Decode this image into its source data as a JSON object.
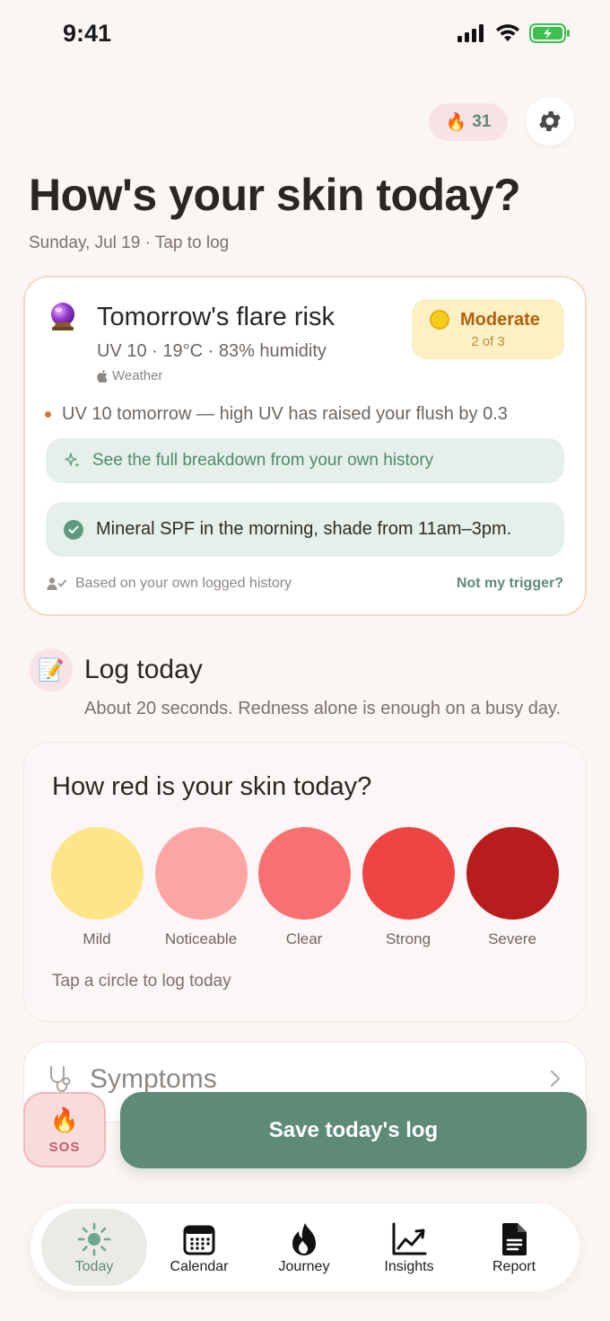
{
  "status_bar": {
    "time": "9:41"
  },
  "header": {
    "streak_count": "31",
    "streak_emoji": "🔥"
  },
  "page": {
    "title": "How's your skin today?",
    "subtitle": "Sunday, Jul 19 · Tap to log"
  },
  "flare_card": {
    "emoji": "🔮",
    "title": "Tomorrow's flare risk",
    "conditions": "UV 10 · 19°C · 83% humidity",
    "weather_source": "Weather",
    "risk_label": "Moderate",
    "risk_level": "2 of 3",
    "trigger_note": "UV 10 tomorrow — high UV has raised your flush by 0.3",
    "breakdown_link": "See the full breakdown from your own history",
    "advice": "Mineral SPF in the morning, shade from 11am–3pm.",
    "based_on": "Based on your own logged history",
    "not_trigger": "Not my trigger?",
    "colors": {
      "risk_bg": "#FDF0C4",
      "risk_text": "#B2610E",
      "accent": "#5E8B77"
    }
  },
  "log_today": {
    "emoji": "📝",
    "title": "Log today",
    "subtitle": "About 20 seconds. Redness alone is enough on a busy day."
  },
  "redness": {
    "question": "How red is your skin today?",
    "options": [
      {
        "label": "Mild",
        "color": "#FDE58A"
      },
      {
        "label": "Noticeable",
        "color": "#FCA5A5"
      },
      {
        "label": "Clear",
        "color": "#F87171"
      },
      {
        "label": "Strong",
        "color": "#EF4444"
      },
      {
        "label": "Severe",
        "color": "#B91C1C"
      }
    ],
    "hint": "Tap a circle to log today"
  },
  "symptoms": {
    "label": "Symptoms"
  },
  "actions": {
    "sos_emoji": "🔥",
    "sos_label": "SOS",
    "save_label": "Save today's log"
  },
  "tabbar": {
    "tabs": [
      {
        "label": "Today",
        "icon": "sun-icon",
        "active": true
      },
      {
        "label": "Calendar",
        "icon": "calendar-icon",
        "active": false
      },
      {
        "label": "Journey",
        "icon": "flame-icon",
        "active": false
      },
      {
        "label": "Insights",
        "icon": "chart-icon",
        "active": false
      },
      {
        "label": "Report",
        "icon": "document-icon",
        "active": false
      }
    ]
  }
}
